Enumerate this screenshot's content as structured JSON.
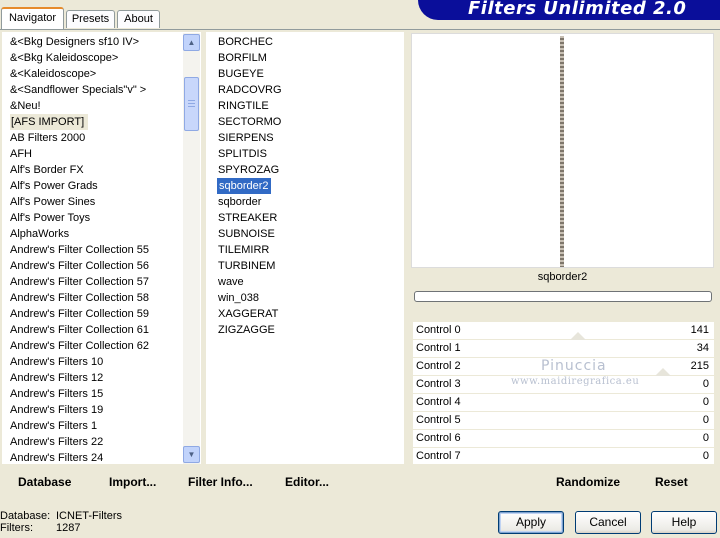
{
  "tabs": [
    {
      "label": "Navigator",
      "active": true
    },
    {
      "label": "Presets",
      "active": false
    },
    {
      "label": "About",
      "active": false
    }
  ],
  "banner_title": "Filters Unlimited 2.0",
  "categories": [
    "&<Bkg Designers sf10 IV>",
    "&<Bkg Kaleidoscope>",
    "&<Kaleidoscope>",
    "&<Sandflower Specials\"v\" >",
    "&Neu!",
    "[AFS IMPORT]",
    "AB Filters 2000",
    "AFH",
    "Alf's Border FX",
    "Alf's Power Grads",
    "Alf's Power Sines",
    "Alf's Power Toys",
    "AlphaWorks",
    "Andrew's Filter Collection 55",
    "Andrew's Filter Collection 56",
    "Andrew's Filter Collection 57",
    "Andrew's Filter Collection 58",
    "Andrew's Filter Collection 59",
    "Andrew's Filter Collection 61",
    "Andrew's Filter Collection 62",
    "Andrew's Filters 10",
    "Andrew's Filters 12",
    "Andrew's Filters 15",
    "Andrew's Filters 19",
    "Andrew's Filters 1",
    "Andrew's Filters 22",
    "Andrew's Filters 24"
  ],
  "selected_category": "[AFS IMPORT]",
  "filters": [
    "BORCHEC",
    "BORFILM",
    "BUGEYE",
    "RADCOVRG",
    "RINGTILE",
    "SECTORMO",
    "SIERPENS",
    "SPLITDIS",
    "SPYROZAG",
    "sqborder2",
    "sqborder",
    "STREAKER",
    "SUBNOISE",
    "TILEMIRR",
    "TURBINEM",
    "wave",
    "win_038",
    "XAGGERAT",
    "ZIGZAGGE"
  ],
  "selected_filter": "sqborder2",
  "nav_buttons": {
    "database": "Database",
    "import": "Import...",
    "filter_info": "Filter Info...",
    "editor": "Editor..."
  },
  "preview_filter_name": "sqborder2",
  "controls": [
    {
      "label": "Control 0",
      "value": "141"
    },
    {
      "label": "Control 1",
      "value": "34"
    },
    {
      "label": "Control 2",
      "value": "215"
    },
    {
      "label": "Control 3",
      "value": "0"
    },
    {
      "label": "Control 4",
      "value": "0"
    },
    {
      "label": "Control 5",
      "value": "0"
    },
    {
      "label": "Control 6",
      "value": "0"
    },
    {
      "label": "Control 7",
      "value": "0"
    }
  ],
  "watermark": {
    "name": "Pinuccia",
    "site": "www.maidiregrafica.eu"
  },
  "randomize_label": "Randomize",
  "reset_label": "Reset",
  "status": {
    "database_label": "Database:",
    "database_value": "ICNET-Filters",
    "filters_label": "Filters:",
    "filters_value": "1287"
  },
  "dialog_buttons": {
    "apply": "Apply",
    "cancel": "Cancel",
    "help": "Help"
  },
  "colors": {
    "banner": "#0a0e9a",
    "selection": "#316ac5",
    "tab_accent": "#e68b2c"
  }
}
